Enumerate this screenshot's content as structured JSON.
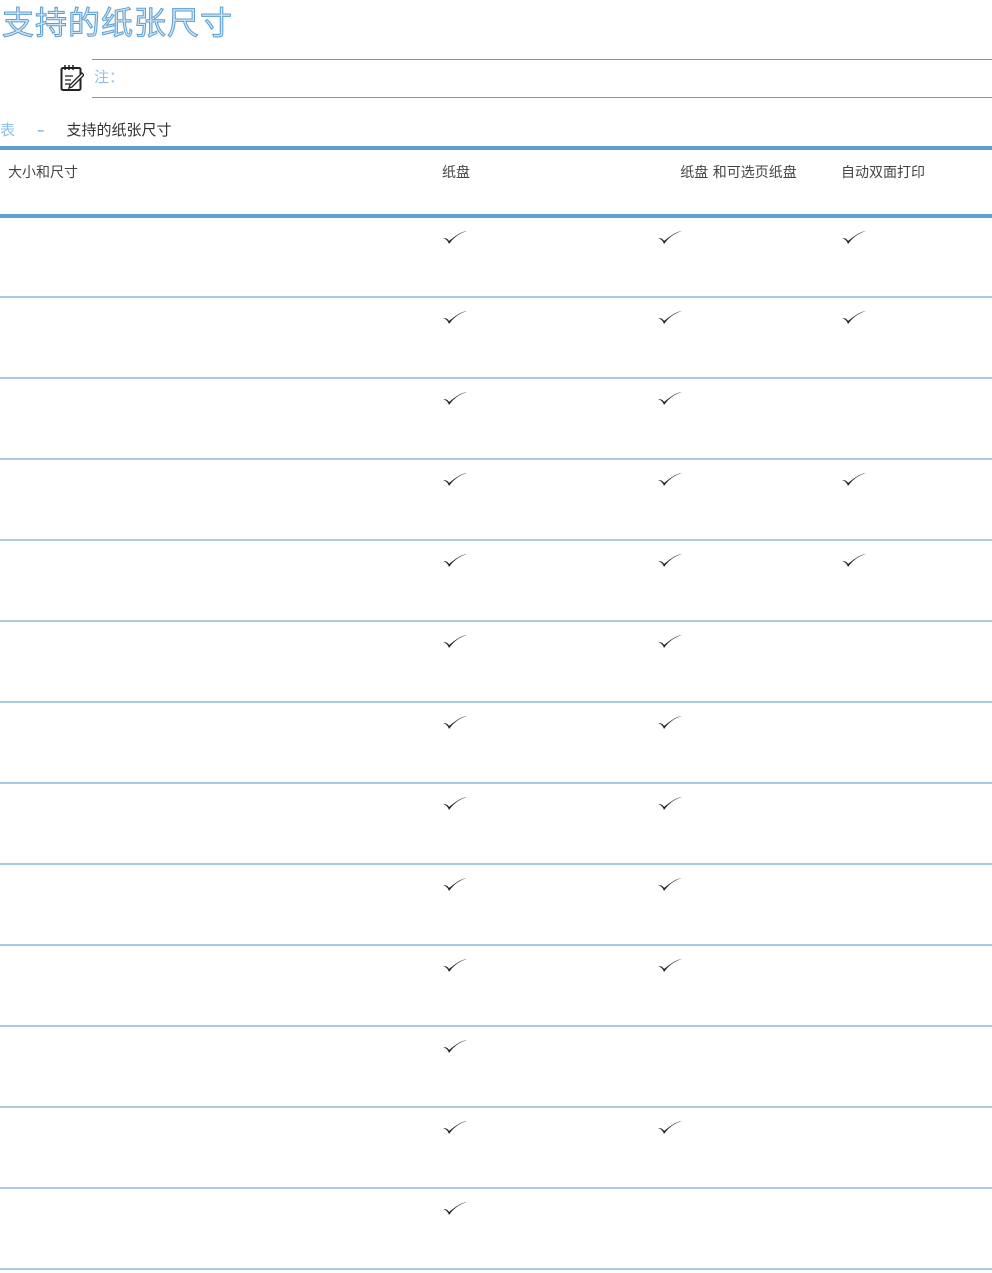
{
  "title": "支持的纸张尺寸",
  "note": {
    "label": "注："
  },
  "caption": {
    "prefix": "表",
    "dash": "–",
    "text": "支持的纸张尺寸"
  },
  "columns": [
    "大小和尺寸",
    "纸盘",
    "纸盘 和可选页纸盘",
    "自动双面打印"
  ],
  "rows": [
    {
      "size": "",
      "tray": true,
      "optional": true,
      "duplex": true
    },
    {
      "size": "",
      "tray": true,
      "optional": true,
      "duplex": true
    },
    {
      "size": "",
      "tray": true,
      "optional": true,
      "duplex": false
    },
    {
      "size": "",
      "tray": true,
      "optional": true,
      "duplex": true
    },
    {
      "size": "",
      "tray": true,
      "optional": true,
      "duplex": true
    },
    {
      "size": "",
      "tray": true,
      "optional": true,
      "duplex": false
    },
    {
      "size": "",
      "tray": true,
      "optional": true,
      "duplex": false
    },
    {
      "size": "",
      "tray": true,
      "optional": true,
      "duplex": false
    },
    {
      "size": "",
      "tray": true,
      "optional": true,
      "duplex": false
    },
    {
      "size": "",
      "tray": true,
      "optional": true,
      "duplex": false
    },
    {
      "size": "",
      "tray": true,
      "optional": false,
      "duplex": false
    },
    {
      "size": "",
      "tray": true,
      "optional": true,
      "duplex": false
    },
    {
      "size": "",
      "tray": true,
      "optional": false,
      "duplex": false
    }
  ]
}
